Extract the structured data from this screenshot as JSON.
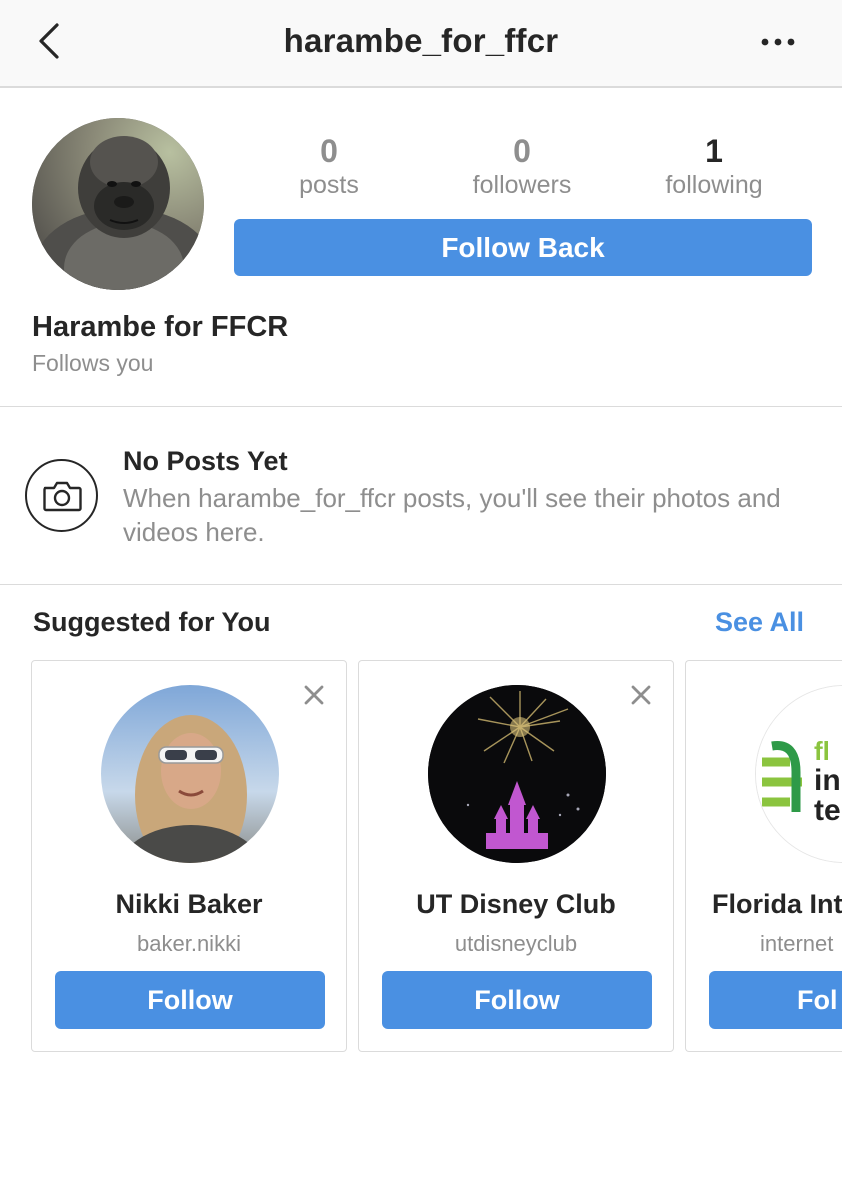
{
  "nav": {
    "title": "harambe_for_ffcr",
    "back_icon": "chevron-left-icon",
    "more_icon": "more-dots-icon"
  },
  "profile": {
    "stats": [
      {
        "value": "0",
        "label": "posts"
      },
      {
        "value": "0",
        "label": "followers"
      },
      {
        "value": "1",
        "label": "following"
      }
    ],
    "follow_back_label": "Follow Back",
    "name": "Harambe for FFCR",
    "relation": "Follows you"
  },
  "no_posts": {
    "title": "No Posts Yet",
    "body": "When harambe_for_ffcr posts, you'll see their photos and videos here."
  },
  "suggested": {
    "title": "Suggested for You",
    "see_all": "See All",
    "cards": [
      {
        "name": "Nikki Baker",
        "handle": "baker.nikki",
        "button": "Follow"
      },
      {
        "name": "UT Disney Club",
        "handle": "utdisneyclub",
        "button": "Follow"
      },
      {
        "name": "Florida Int",
        "handle": "internet",
        "button": "Fol"
      }
    ]
  },
  "colors": {
    "accent": "#4a90e2",
    "text_primary": "#262626",
    "text_secondary": "#8e8e8e",
    "divider": "#dbdbdb"
  }
}
